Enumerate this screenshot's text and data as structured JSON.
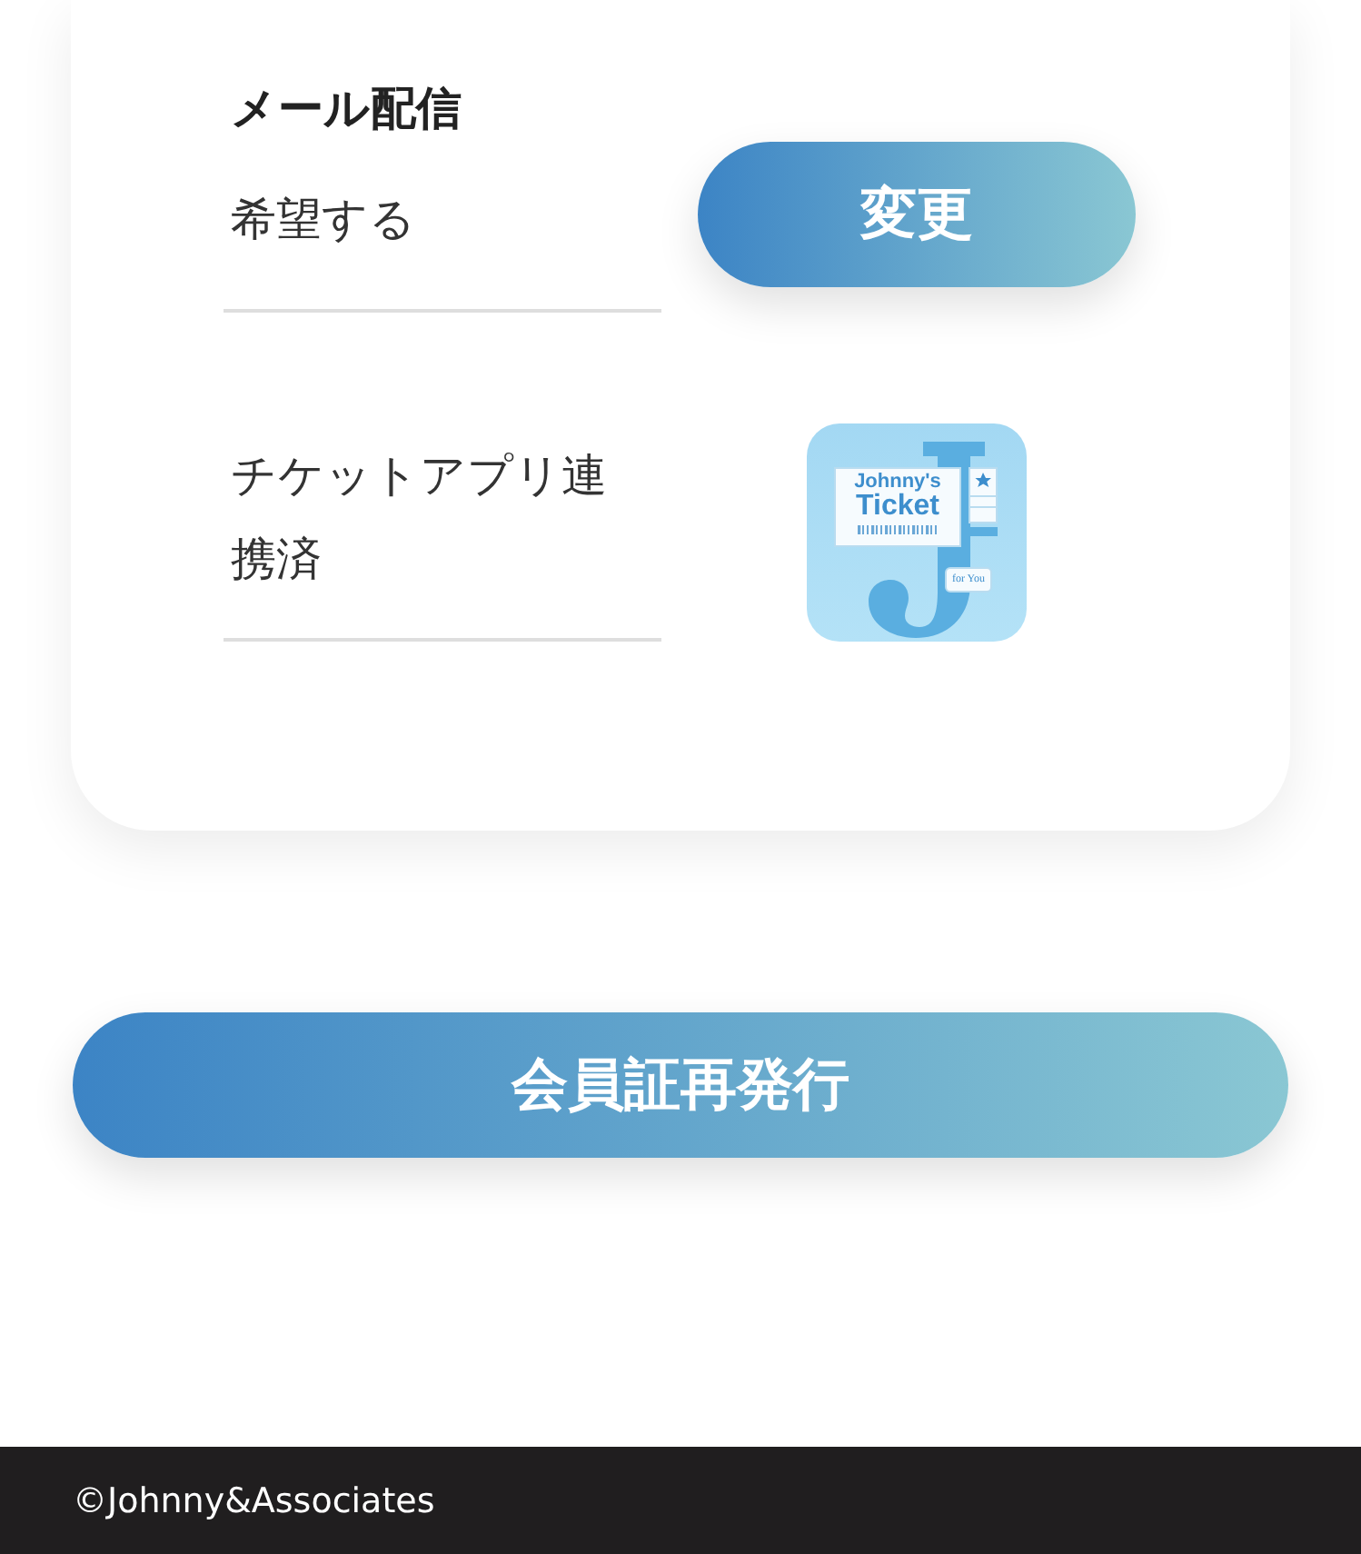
{
  "settings": [
    {
      "kind": "button",
      "title": "メール配信",
      "value": "希望する",
      "button": "変更"
    },
    {
      "kind": "app",
      "value": "チケットアプリ連携済",
      "app_icon": {
        "line1": "Johnny's",
        "line2": "Ticket",
        "tag": "for You"
      }
    }
  ],
  "reissue_button": "会員証再発行",
  "footer": "©Johnny&Associates"
}
